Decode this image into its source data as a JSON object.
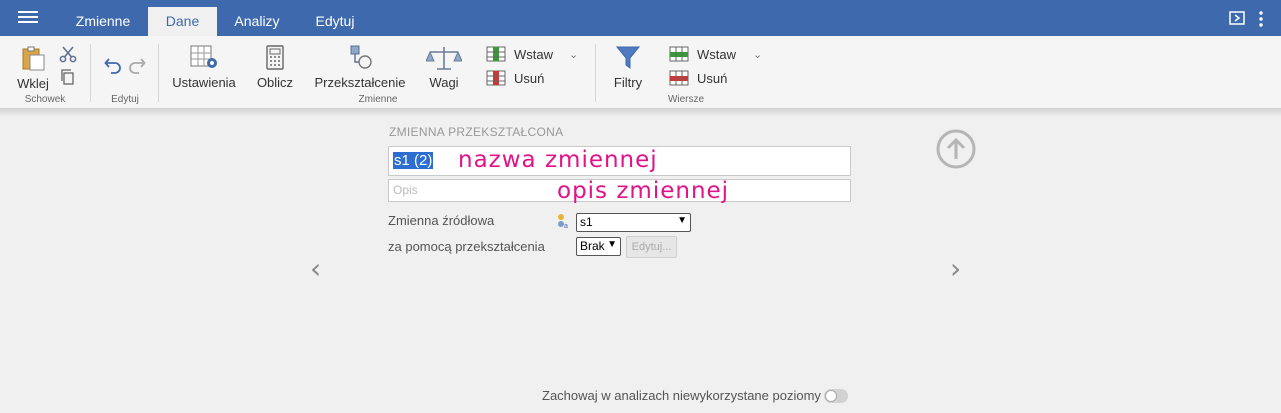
{
  "tabs": [
    {
      "label": "Zmienne",
      "active": false
    },
    {
      "label": "Dane",
      "active": true
    },
    {
      "label": "Analizy",
      "active": false
    },
    {
      "label": "Edytuj",
      "active": false
    }
  ],
  "ribbon": {
    "paste_label": "Wklej",
    "undo_group_label": "Edytuj",
    "clipboard_group_label": "Schowek",
    "settings_label": "Ustawienia",
    "compute_label": "Oblicz",
    "transform_label": "Przekształcenie",
    "weights_label": "Wagi",
    "insert_var_label": "Wstaw",
    "delete_var_label": "Usuń",
    "variables_group_label": "Zmienne",
    "filters_label": "Filtry",
    "insert_row_label": "Wstaw",
    "delete_row_label": "Usuń",
    "rows_group_label": "Wiersze"
  },
  "form": {
    "section_title": "ZMIENNA PRZEKSZTAŁCONA",
    "name_value": "s1 (2)",
    "desc_placeholder": "Opis",
    "source_label": "Zmienna źródłowa",
    "source_value": "s1",
    "transform_label": "za pomocą przekształcenia",
    "transform_value": "Brak",
    "edit_button": "Edytuj..."
  },
  "annotations": {
    "name": "nazwa zmiennej",
    "desc": "opis zmiennej"
  },
  "bottom": {
    "keep_levels_label": "Zachowaj w analizach niewykorzystane poziomy",
    "keep_levels_on": false
  },
  "colors": {
    "topbar": "#3e6aad",
    "annotation": "#e0138a"
  }
}
